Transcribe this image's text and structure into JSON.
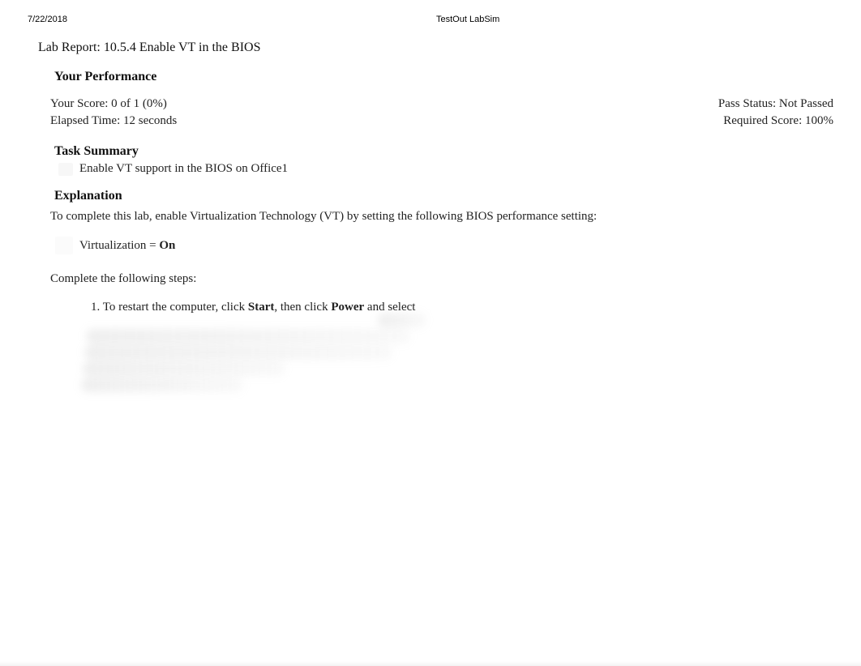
{
  "header": {
    "date": "7/22/2018",
    "app_title": "TestOut LabSim"
  },
  "report": {
    "title": "Lab Report: 10.5.4 Enable VT in the BIOS"
  },
  "performance": {
    "heading": "Your Performance",
    "score_label": "Your Score: 0 of 1 (0%)",
    "pass_status": "Pass Status: Not Passed",
    "elapsed": "Elapsed Time: 12 seconds",
    "required": "Required Score: 100%"
  },
  "task_summary": {
    "heading": "Task Summary",
    "items": [
      "Enable VT support in the BIOS on Office1"
    ]
  },
  "explanation": {
    "heading": "Explanation",
    "intro": "To complete this lab, enable Virtualization Technology (VT) by setting the following BIOS performance setting:",
    "setting_prefix": "Virtualization = ",
    "setting_value": "On",
    "steps_intro": "Complete the following steps:",
    "steps": [
      {
        "number": "1. ",
        "prefix": "To restart the computer, click ",
        "bold1": "Start",
        "mid": ", then click ",
        "bold2": "Power",
        "suffix": " and select"
      }
    ]
  }
}
